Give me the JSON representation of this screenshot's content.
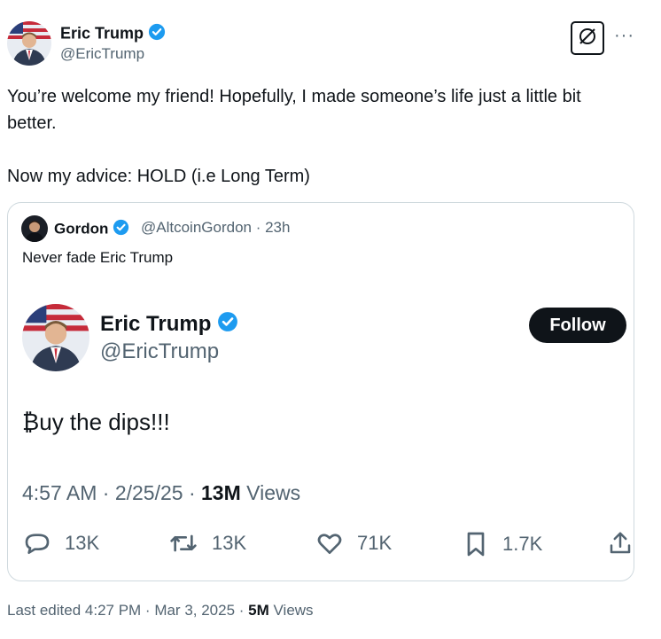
{
  "tweet": {
    "author_name": "Eric Trump",
    "author_handle": "@EricTrump",
    "text": "You’re welcome my friend! Hopefully, I made someone’s life just a little bit better.\n\nNow my advice: HOLD (i.e Long Term)",
    "last_edited": "Last edited 4:27 PM · Mar 3, 2025 · ",
    "views_count": "5M",
    "views_label": "Views",
    "more_label": "···"
  },
  "quote": {
    "author_name": "Gordon",
    "author_handle": "@AltcoinGordon · 23h",
    "text": "Never fade Eric Trump",
    "embed": {
      "author_name": "Eric Trump",
      "author_handle": "@EricTrump",
      "follow_label": "Follow",
      "text": "₿uy the dips!!!",
      "meta": "4:57 AM · 2/25/25 · ",
      "views_count": "13M",
      "views_label": "Views",
      "replies": "13K",
      "reposts": "13K",
      "likes": "71K",
      "bookmarks": "1.7K"
    }
  },
  "colors": {
    "verified": "#1d9bf0",
    "secondary_text": "#536471",
    "border": "#cfd9de"
  },
  "icons": [
    "verified-badge-icon",
    "grok-icon",
    "more-icon",
    "reply-icon",
    "repost-icon",
    "like-icon",
    "bookmark-icon",
    "share-icon"
  ]
}
